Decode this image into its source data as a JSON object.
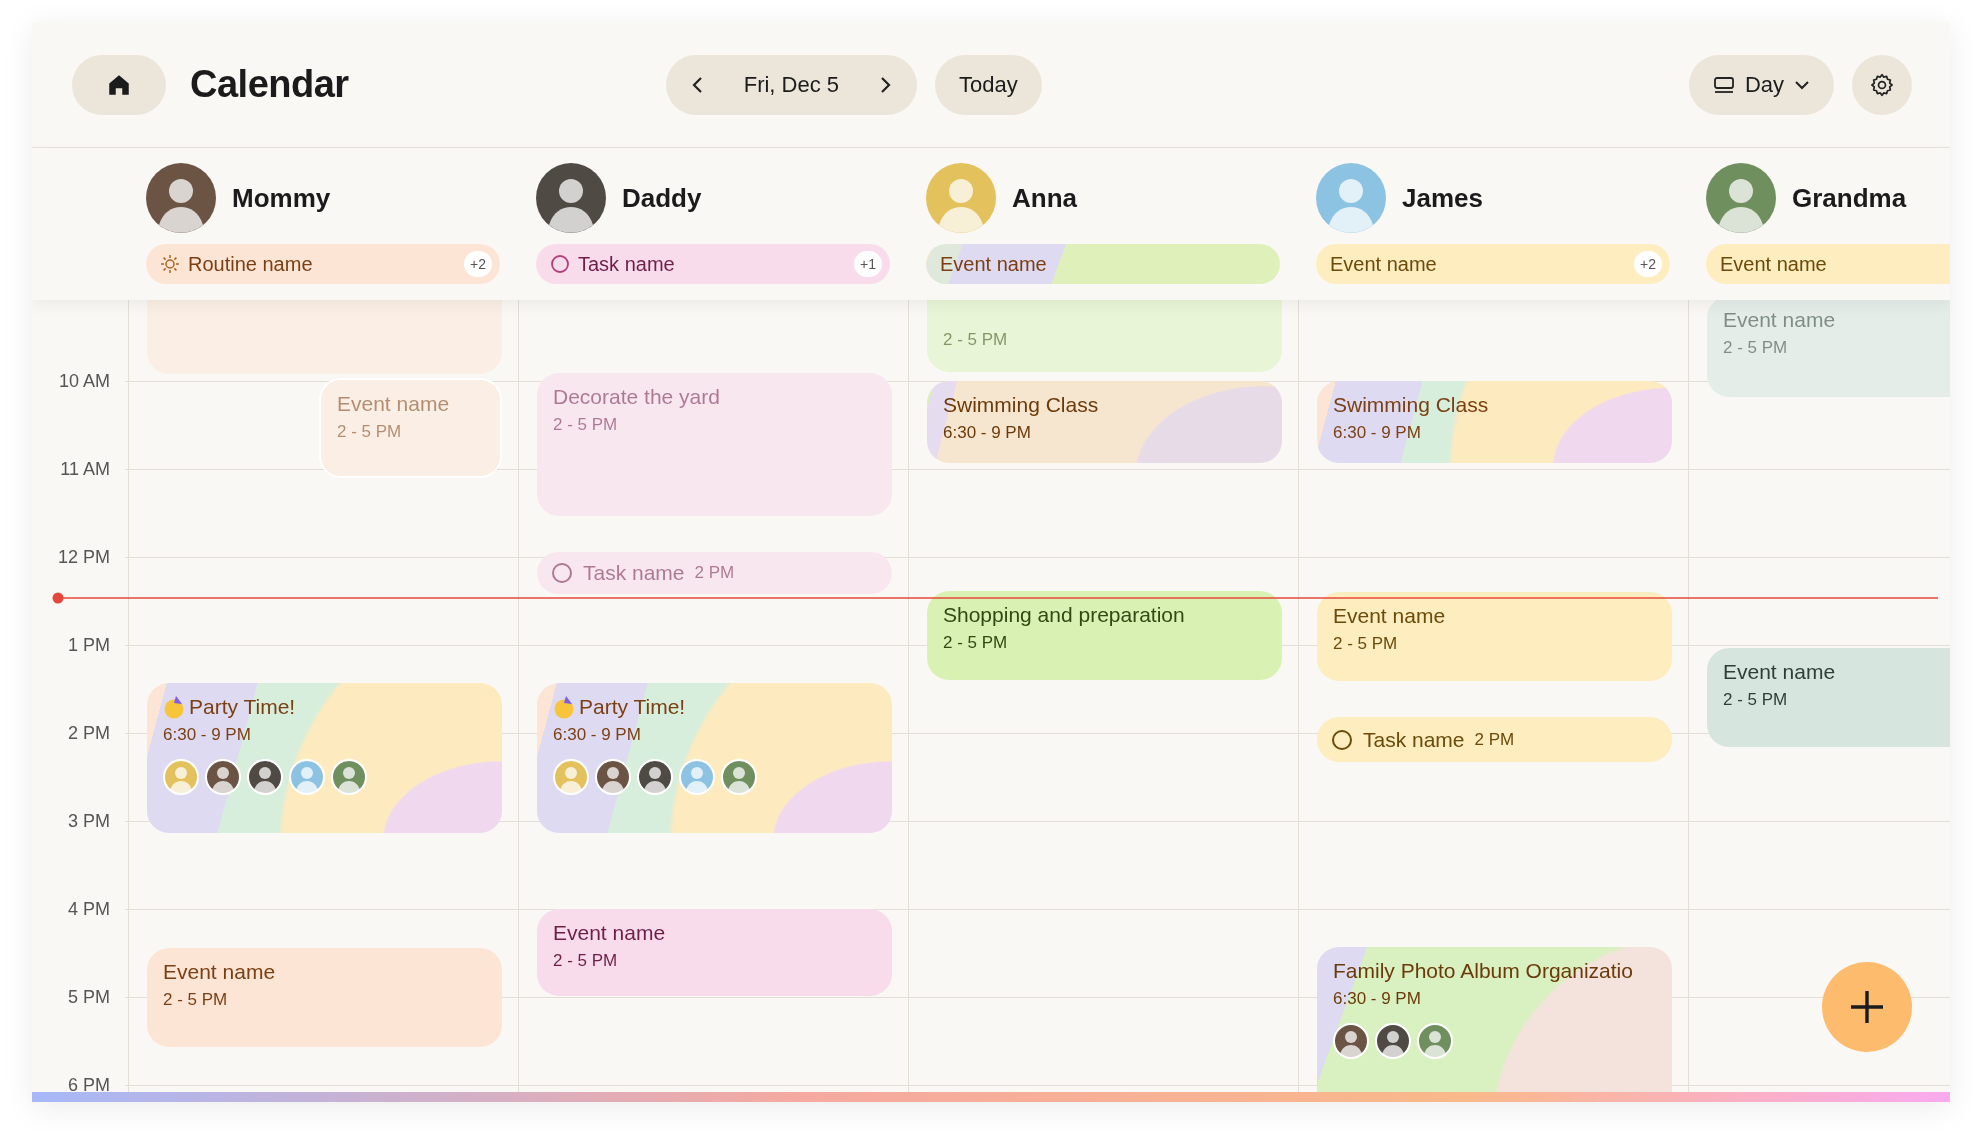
{
  "header": {
    "title": "Calendar",
    "date": "Fri, Dec 5",
    "today": "Today",
    "view": "Day"
  },
  "hours": [
    "10 AM",
    "11 AM",
    "12 PM",
    "1 PM",
    "2 PM",
    "3 PM",
    "4 PM",
    "5 PM",
    "6 PM"
  ],
  "columns": [
    {
      "name": "Mommy",
      "color": "#6b5444",
      "pill": {
        "kind": "routine",
        "color": "#fde5d6",
        "label": "Routine name",
        "count": "+2"
      },
      "events": [
        {
          "kind": "plain",
          "color": "#fbeee4"
        },
        {
          "kind": "plain",
          "color": "#fbeee4",
          "faded": true,
          "title": "Event name",
          "time": "2 - 5 PM"
        },
        {
          "kind": "rainbow",
          "color": "#fde5d6",
          "faded": false,
          "title": "Party Time!",
          "time": "6:30 - 9 PM",
          "avatars": [
            {
              "color": "#e3c15c"
            },
            {
              "color": "#6b5444"
            },
            {
              "color": "#4f4a44"
            },
            {
              "color": "#8cc3e3"
            },
            {
              "color": "#6f8f5f"
            }
          ]
        },
        {
          "kind": "plain",
          "color": "#fde5d6",
          "faded": false,
          "title": "Event name",
          "time": "2 - 5 PM"
        }
      ]
    },
    {
      "name": "Daddy",
      "color": "#4f4a44",
      "pill": {
        "kind": "task",
        "color": "#f9dceb",
        "label": "Task name",
        "count": "+1"
      },
      "events": [
        {
          "kind": "plain",
          "color": "#f9e7ef",
          "faded": true,
          "title": "Decorate the yard",
          "time": "2 - 5 PM"
        },
        {
          "kind": "task",
          "color": "#f9e7ef",
          "faded": true,
          "title": "Task name",
          "time": "2 PM"
        },
        {
          "kind": "rainbow",
          "color": "#fde5d6",
          "faded": false,
          "title": "Party Time!",
          "time": "6:30 - 9 PM",
          "avatars": [
            {
              "color": "#e3c15c"
            },
            {
              "color": "#6b5444"
            },
            {
              "color": "#4f4a44"
            },
            {
              "color": "#8cc3e3"
            },
            {
              "color": "#6f8f5f"
            }
          ]
        },
        {
          "kind": "plain",
          "color": "#f9dceb",
          "faded": false,
          "title": "Event name",
          "time": "2 - 5 PM"
        }
      ]
    },
    {
      "name": "Anna",
      "color": "#e3c15c",
      "pill": {
        "kind": "blend",
        "color": "#dff0bb",
        "label": "Event name"
      },
      "events": [
        {
          "kind": "plain",
          "color": "#e8f5d6",
          "faded": true,
          "time": "2 - 5 PM"
        },
        {
          "kind": "dusk",
          "color": "#f6e6cf",
          "faded": false,
          "title": "Swimming Class",
          "time": "6:30 - 9 PM"
        },
        {
          "kind": "plain",
          "color": "#d9f2b4",
          "faded": false,
          "title": "Shopping and preparation",
          "time": "2 - 5 PM"
        }
      ]
    },
    {
      "name": "James",
      "color": "#8cc3e3",
      "pill": {
        "kind": "plain",
        "color": "#fdedbf",
        "label": "Event name",
        "count": "+2"
      },
      "events": [
        {
          "kind": "rainbow",
          "color": "#fde5d6",
          "faded": false,
          "title": "Swimming Class",
          "time": "6:30 - 9 PM"
        },
        {
          "kind": "plain",
          "color": "#fdedbf",
          "faded": false,
          "title": "Event name",
          "time": "2 - 5 PM"
        },
        {
          "kind": "task",
          "color": "#fdedbf",
          "faded": false,
          "title": "Task name",
          "time": "2 PM"
        },
        {
          "kind": "meadow",
          "color": "#d9f0c0",
          "faded": false,
          "title": "Family Photo Album Organizatio",
          "time": "6:30 - 9 PM",
          "avatars": [
            {
              "color": "#6b5444"
            },
            {
              "color": "#4f4a44"
            },
            {
              "color": "#6f8f5f"
            }
          ]
        }
      ]
    },
    {
      "name": "Grandma",
      "color": "#6f8f5f",
      "pill": {
        "kind": "plain",
        "color": "#fdedbf",
        "label": "Event name"
      },
      "events": [
        {
          "kind": "plain",
          "color": "#e5ede9",
          "faded": true,
          "title": "Event name",
          "time": "2 - 5 PM"
        },
        {
          "kind": "plain",
          "color": "#d6e6df",
          "faded": false,
          "title": "Event name",
          "time": "2 - 5 PM"
        }
      ]
    }
  ]
}
